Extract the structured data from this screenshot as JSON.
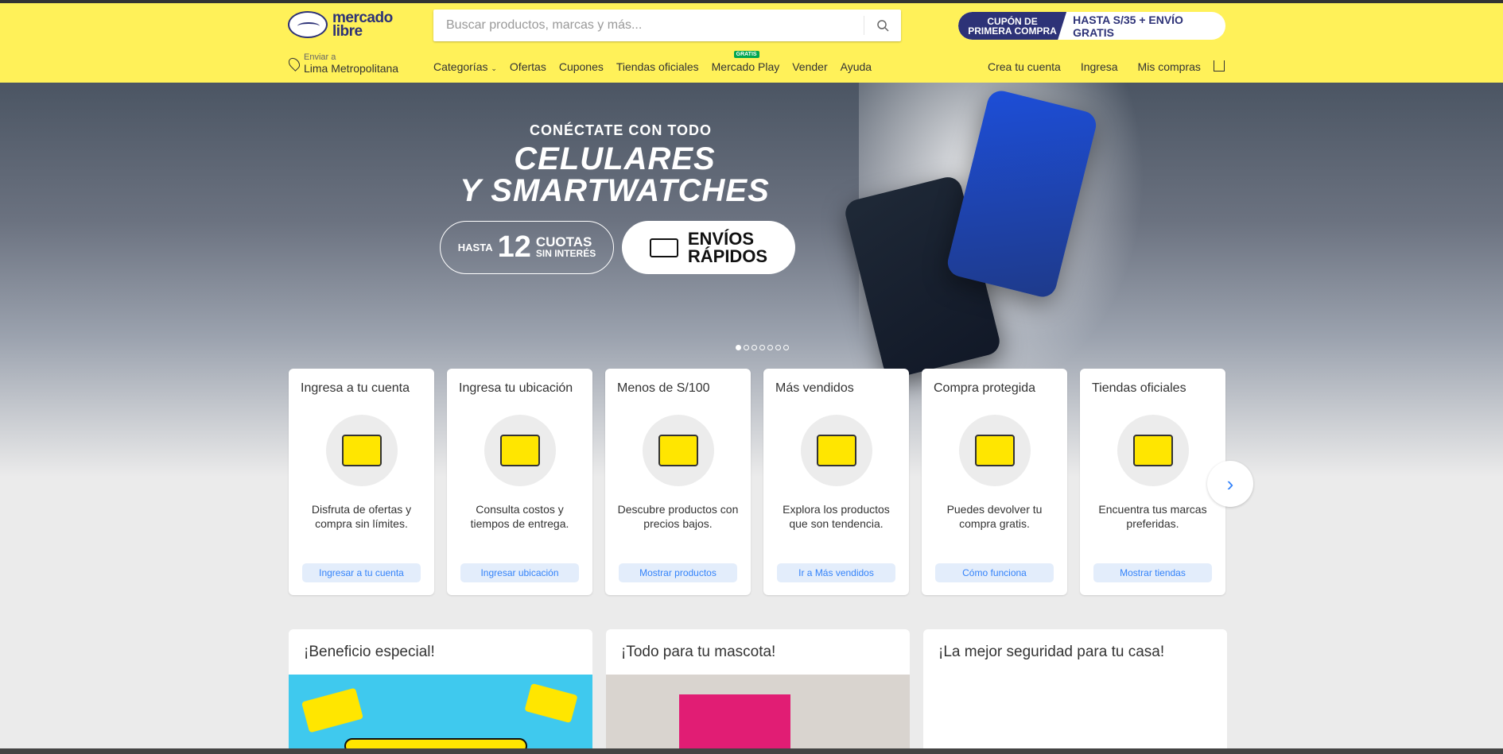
{
  "header": {
    "logo_text_line1": "mercado",
    "logo_text_line2": "libre",
    "search_placeholder": "Buscar productos, marcas y más...",
    "promo_badge_line1": "CUPÓN DE",
    "promo_badge_line2": "PRIMERA COMPRA",
    "promo_text": "HASTA S/35 + ENVÍO GRATIS",
    "location_label": "Enviar a",
    "location_value": "Lima Metropolitana",
    "nav": [
      "Categorías",
      "Ofertas",
      "Cupones",
      "Tiendas oficiales",
      "Mercado Play",
      "Vender",
      "Ayuda"
    ],
    "gratis_badge": "GRATIS",
    "user_nav": [
      "Crea tu cuenta",
      "Ingresa",
      "Mis compras"
    ]
  },
  "hero": {
    "kicker": "CONÉCTATE CON TODO",
    "title_line1": "CELULARES",
    "title_line2": "Y SMARTWATCHES",
    "pill1_prefix": "HASTA",
    "pill1_number": "12",
    "pill1_word": "CUOTAS",
    "pill1_sub": "SIN INTERÉS",
    "pill2_line1": "ENVÍOS",
    "pill2_line2": "RÁPIDOS",
    "slide_count": 7,
    "active_slide": 1
  },
  "cards": [
    {
      "title": "Ingresa a tu cuenta",
      "desc": "Disfruta de ofertas y compra sin límites.",
      "button": "Ingresar a tu cuenta"
    },
    {
      "title": "Ingresa tu ubicación",
      "desc": "Consulta costos y tiempos de entrega.",
      "button": "Ingresar ubicación"
    },
    {
      "title": "Menos de S/100",
      "desc": "Descubre productos con precios bajos.",
      "button": "Mostrar productos"
    },
    {
      "title": "Más vendidos",
      "desc": "Explora los productos que son tendencia.",
      "button": "Ir a Más vendidos"
    },
    {
      "title": "Compra protegida",
      "desc": "Puedes devolver tu compra gratis.",
      "button": "Cómo funciona"
    },
    {
      "title": "Tiendas oficiales",
      "desc": "Encuentra tus marcas preferidas.",
      "button": "Mostrar tiendas"
    }
  ],
  "promos": [
    {
      "title": "¡Beneficio especial!"
    },
    {
      "title": "¡Todo para tu mascota!"
    },
    {
      "title": "¡La mejor seguridad para tu casa!"
    }
  ],
  "colors": {
    "brand_yellow": "#fff159",
    "accent_blue": "#3483fa",
    "logo_navy": "#2d3277"
  }
}
